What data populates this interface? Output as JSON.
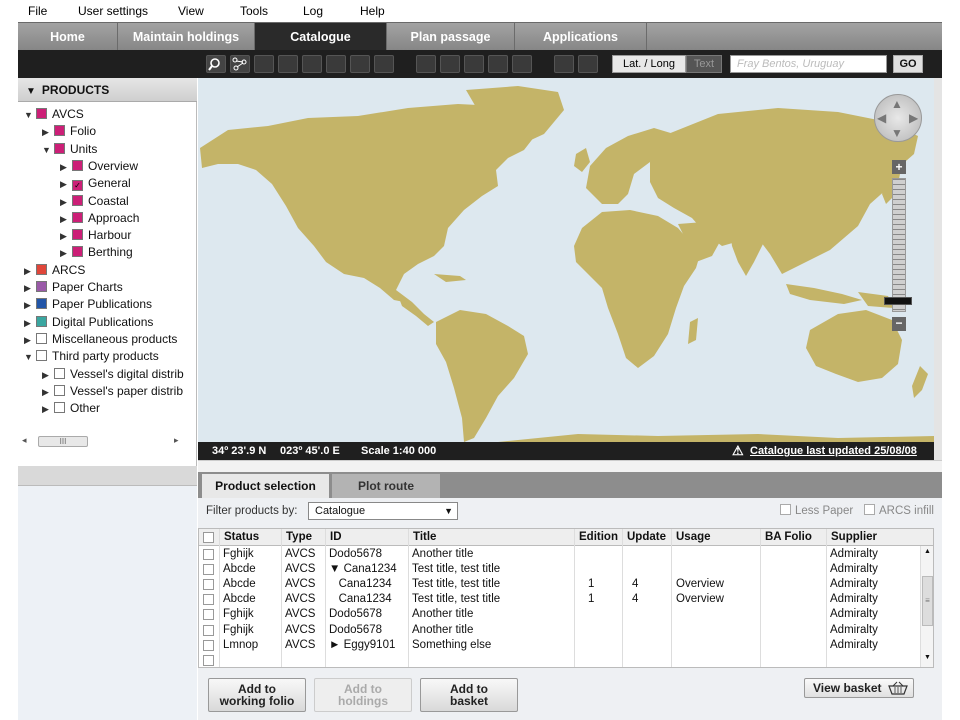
{
  "menu": [
    "File",
    "User settings",
    "View",
    "Tools",
    "Log",
    "Help"
  ],
  "nav_tabs": [
    {
      "label": "Home",
      "active": false
    },
    {
      "label": "Maintain holdings",
      "active": false
    },
    {
      "label": "Catalogue",
      "active": true
    },
    {
      "label": "Plan passage",
      "active": false
    },
    {
      "label": "Applications",
      "active": false
    }
  ],
  "toolbar": {
    "latlong_label": "Lat. / Long",
    "text_label": "Text",
    "search_placeholder": "Fray Bentos, Uruguay",
    "go_label": "GO"
  },
  "products": {
    "title": "PRODUCTS",
    "tree": [
      {
        "label": "AVCS",
        "level": 0,
        "toggle": "▼",
        "color": "#cc1f77",
        "checked": false
      },
      {
        "label": "Folio",
        "level": 1,
        "toggle": "▶",
        "color": "#cc1f77",
        "checked": false
      },
      {
        "label": "Units",
        "level": 1,
        "toggle": "▼",
        "color": "#cc1f77",
        "checked": false
      },
      {
        "label": "Overview",
        "level": 2,
        "toggle": "▶",
        "color": "#cc1f77",
        "checked": false
      },
      {
        "label": "General",
        "level": 2,
        "toggle": "▶",
        "color": "#cc1f77",
        "checked": true
      },
      {
        "label": "Coastal",
        "level": 2,
        "toggle": "▶",
        "color": "#cc1f77",
        "checked": false
      },
      {
        "label": "Approach",
        "level": 2,
        "toggle": "▶",
        "color": "#cc1f77",
        "checked": false
      },
      {
        "label": "Harbour",
        "level": 2,
        "toggle": "▶",
        "color": "#cc1f77",
        "checked": false
      },
      {
        "label": "Berthing",
        "level": 2,
        "toggle": "▶",
        "color": "#cc1f77",
        "checked": false
      },
      {
        "label": "ARCS",
        "level": 0,
        "toggle": "▶",
        "color": "#e0463a",
        "checked": false
      },
      {
        "label": "Paper Charts",
        "level": 0,
        "toggle": "▶",
        "color": "#9a5aa8",
        "checked": false
      },
      {
        "label": "Paper Publications",
        "level": 0,
        "toggle": "▶",
        "color": "#2356a8",
        "checked": false
      },
      {
        "label": "Digital Publications",
        "level": 0,
        "toggle": "▶",
        "color": "#3aa6a0",
        "checked": false
      },
      {
        "label": "Miscellaneous products",
        "level": 0,
        "toggle": "▶",
        "color": "#ffffff",
        "checked": false
      },
      {
        "label": "Third party products",
        "level": 0,
        "toggle": "▼",
        "color": "#ffffff",
        "checked": false
      },
      {
        "label": "Vessel's digital distrib",
        "level": 1,
        "toggle": "▶",
        "color": "#ffffff",
        "checked": false
      },
      {
        "label": "Vessel's paper distrib",
        "level": 1,
        "toggle": "▶",
        "color": "#ffffff",
        "checked": false
      },
      {
        "label": "Other",
        "level": 1,
        "toggle": "▶",
        "color": "#ffffff",
        "checked": false
      }
    ],
    "scroll_thumb": "III"
  },
  "map": {
    "lat": "34º 23'.9 N",
    "long": "023º 45'.0  E",
    "scale": "Scale 1:40 000",
    "updated": "Catalogue last updated  25/08/08",
    "land_color": "#c4b468",
    "sea_color": "#dde8ef",
    "zoom_in": "+",
    "zoom_out": "−"
  },
  "lower_tabs": [
    {
      "label": "Product selection",
      "active": true
    },
    {
      "label": "Plot route",
      "active": false
    }
  ],
  "filter": {
    "label": "Filter products by:",
    "value": "Catalogue",
    "less_paper": "Less Paper",
    "arcs_infill": "ARCS infill"
  },
  "grid": {
    "columns": [
      "Status",
      "Type",
      "ID",
      "Title",
      "Edition",
      "Update",
      "Usage",
      "BA Folio",
      "Supplier"
    ],
    "rows": [
      {
        "status": "Fghijk",
        "type": "AVCS",
        "id": "Dodo5678",
        "title": "Another title",
        "edition": "",
        "update": "",
        "usage": "",
        "folio": "",
        "supplier": "Admiralty"
      },
      {
        "status": "Abcde",
        "type": "AVCS",
        "id": "▼ Cana1234",
        "title": "Test title, test title",
        "edition": "",
        "update": "",
        "usage": "",
        "folio": "",
        "supplier": "Admiralty"
      },
      {
        "status": "Abcde",
        "type": "AVCS",
        "id": "   Cana1234",
        "title": "Test title, test title",
        "edition": "1",
        "update": "4",
        "usage": "Overview",
        "folio": "",
        "supplier": "Admiralty"
      },
      {
        "status": "Abcde",
        "type": "AVCS",
        "id": "   Cana1234",
        "title": "Test title, test title",
        "edition": "1",
        "update": "4",
        "usage": "Overview",
        "folio": "",
        "supplier": "Admiralty"
      },
      {
        "status": "Fghijk",
        "type": "AVCS",
        "id": "Dodo5678",
        "title": "Another title",
        "edition": "",
        "update": "",
        "usage": "",
        "folio": "",
        "supplier": "Admiralty"
      },
      {
        "status": "Fghijk",
        "type": "AVCS",
        "id": "Dodo5678",
        "title": "Another title",
        "edition": "",
        "update": "",
        "usage": "",
        "folio": "",
        "supplier": "Admiralty"
      },
      {
        "status": "Lmnop",
        "type": "AVCS",
        "id": "► Eggy9101",
        "title": "Something else",
        "edition": "",
        "update": "",
        "usage": "",
        "folio": "",
        "supplier": "Admiralty"
      },
      {
        "status": "",
        "type": "",
        "id": "",
        "title": "",
        "edition": "",
        "update": "",
        "usage": "",
        "folio": "",
        "supplier": ""
      }
    ]
  },
  "buttons": {
    "add_folio_1": "Add to",
    "add_folio_2": "working folio",
    "add_hold_1": "Add to",
    "add_hold_2": "holdings",
    "add_basket_1": "Add to",
    "add_basket_2": "basket",
    "view_basket": "View basket"
  }
}
